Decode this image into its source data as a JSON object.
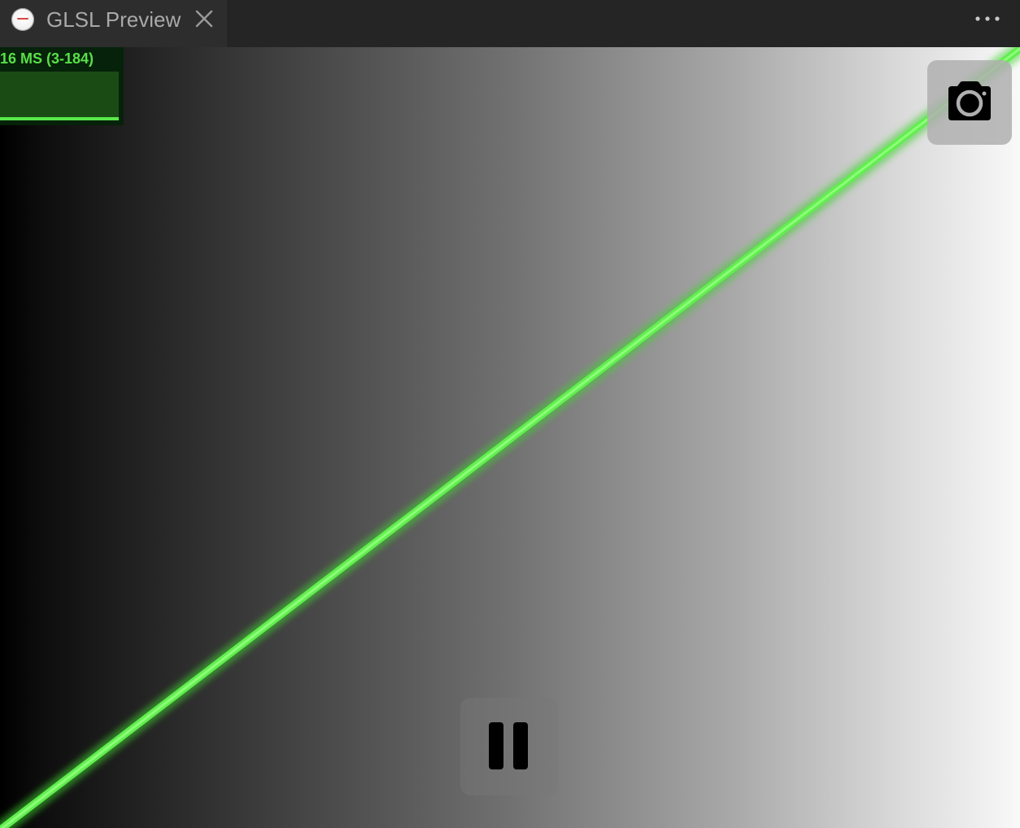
{
  "window": {
    "tab_title": "GLSL Preview",
    "tab_icon": "app-logo-icon",
    "close_icon": "close-icon",
    "more_icon": "more-icon"
  },
  "preview": {
    "stats_text": "16 MS (3-184)",
    "stats_color": "#58e048",
    "beam_color": "#5ae84a",
    "screenshot_icon": "camera-icon",
    "pause_icon": "pause-icon"
  }
}
